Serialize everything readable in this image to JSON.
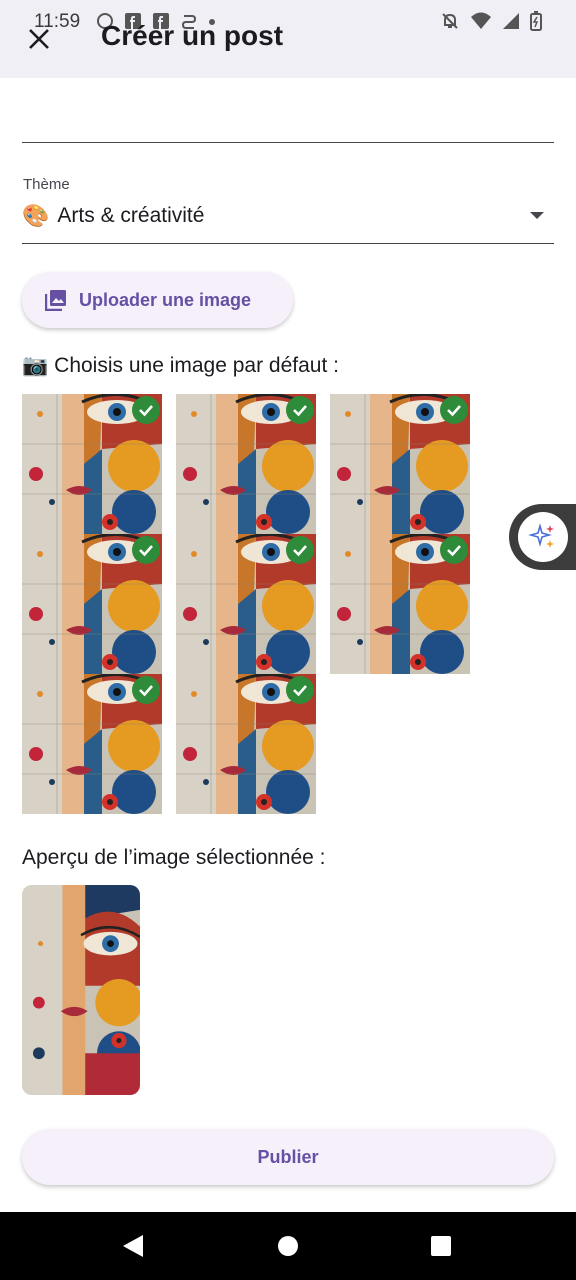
{
  "status_bar": {
    "time": "11:59"
  },
  "header": {
    "title": "Créer un post"
  },
  "title_field": {
    "value": ""
  },
  "theme": {
    "label": "Thème",
    "emoji": "🎨",
    "value": "Arts & créativité"
  },
  "upload": {
    "label": "Uploader une image"
  },
  "default_images": {
    "heading_emoji": "📷",
    "heading": "Choisis une image par défaut :",
    "count": 8,
    "selected": [
      true,
      true,
      true,
      true,
      true,
      true,
      true,
      true
    ]
  },
  "preview": {
    "heading": "Aperçu de l’image sélectionnée :"
  },
  "publish": {
    "label": "Publier"
  },
  "colors": {
    "accent": "#6750a4",
    "check": "#2e8b3a",
    "button_bg": "#f6f0fb"
  }
}
